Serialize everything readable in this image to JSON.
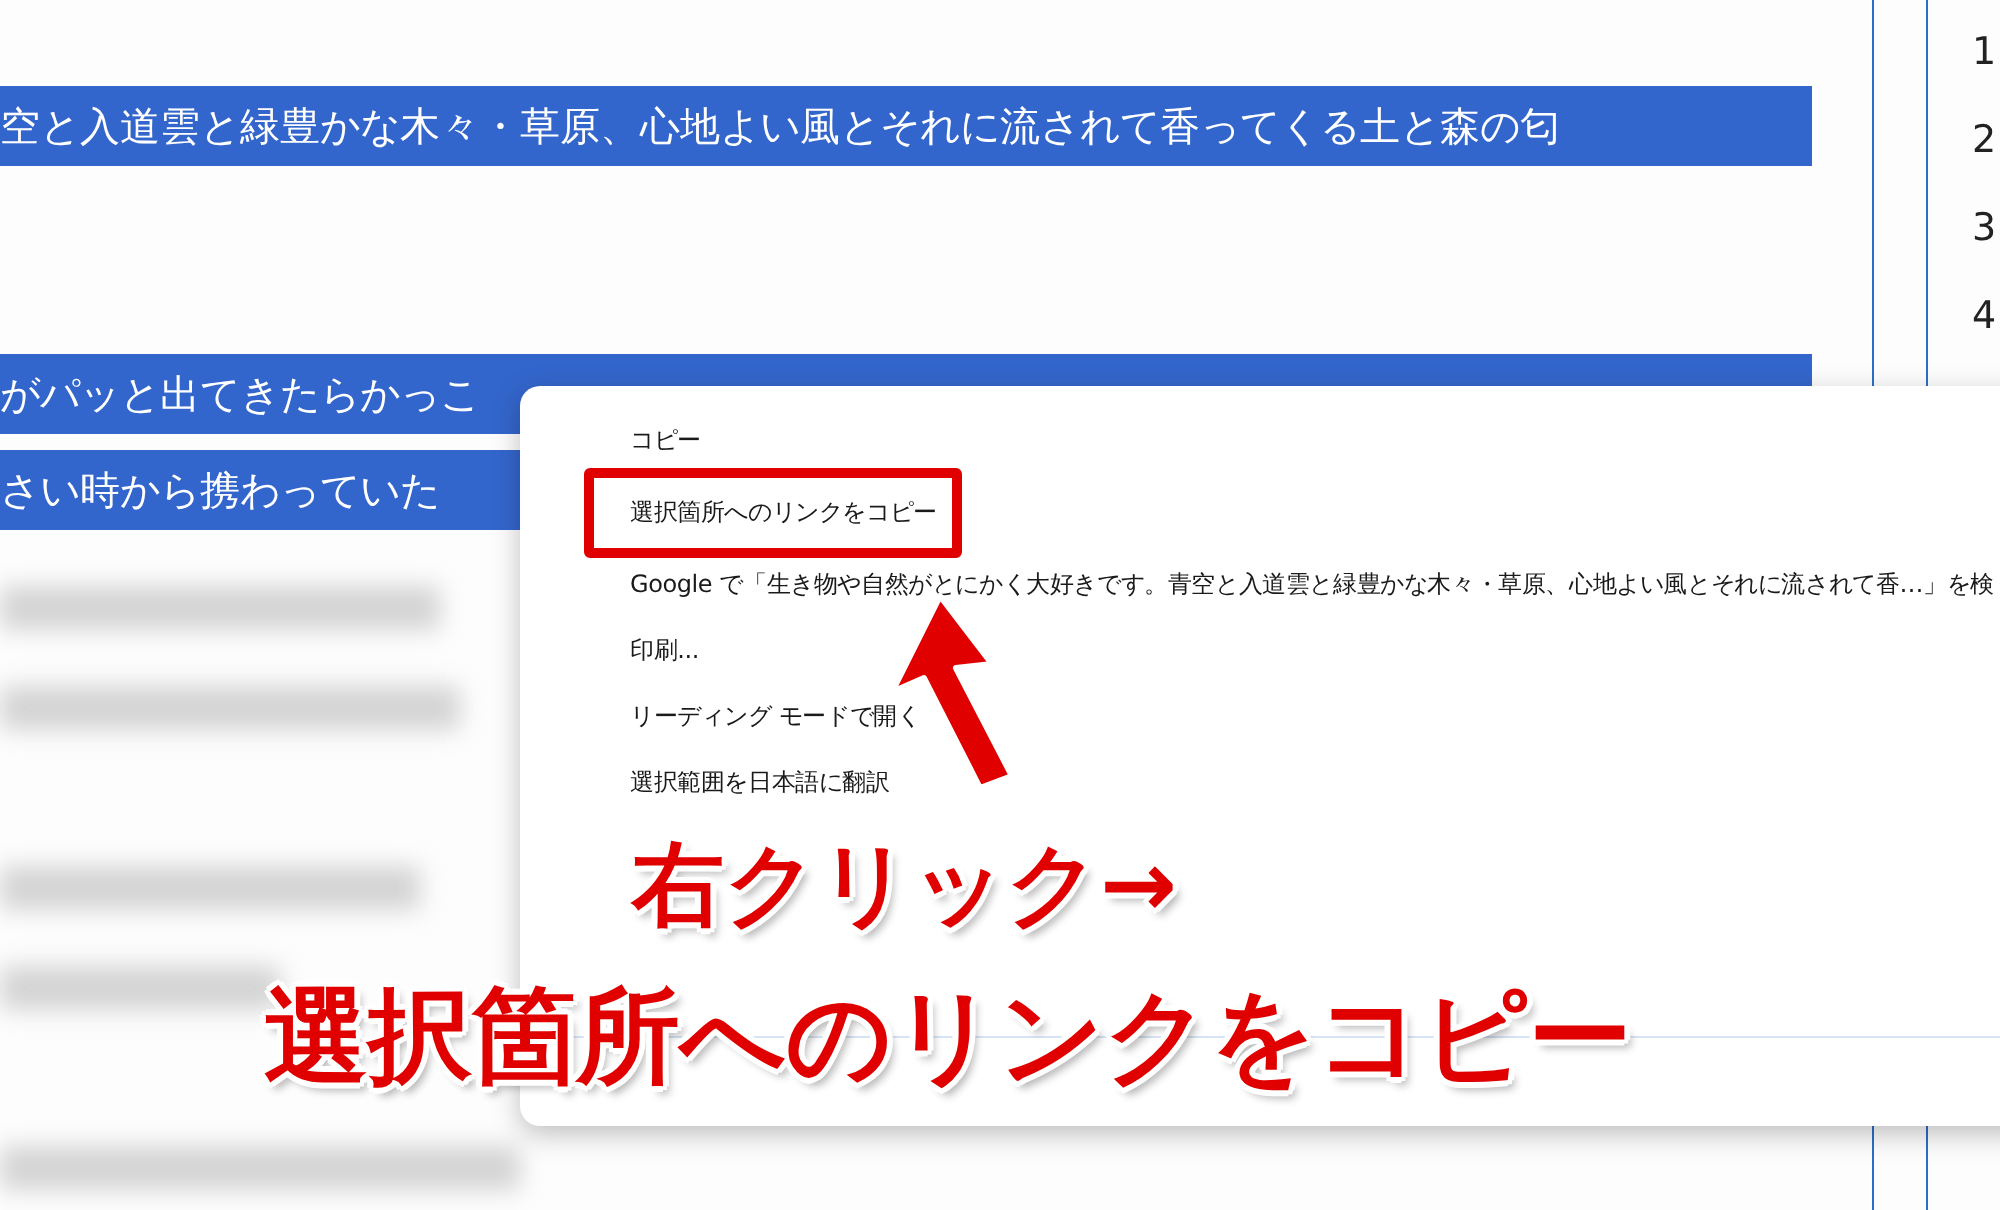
{
  "article": {
    "selected_lines": [
      "空と入道雲と緑豊かな木々・草原、心地よい風とそれに流されて香ってくる土と森の匂",
      "がパッと出てきたらかっこ",
      "さい時から携わっていた"
    ]
  },
  "sidebar": {
    "numbers": [
      "1",
      "2",
      "3",
      "4"
    ]
  },
  "context_menu": {
    "items": [
      {
        "label": "コピー",
        "highlighted": false
      },
      {
        "label": "選択箇所へのリンクをコピー",
        "highlighted": true
      },
      {
        "label": "Google で「生き物や自然がとにかく大好きです。青空と入道雲と緑豊かな木々・草原、心地よい風とそれに流されて香…」を検",
        "highlighted": false
      },
      {
        "label": "印刷...",
        "highlighted": false
      },
      {
        "label": "リーディング モードで開く",
        "highlighted": false
      },
      {
        "label": "選択範囲を日本語に翻訳",
        "highlighted": false
      }
    ]
  },
  "annotation": {
    "lines": [
      "右クリック→",
      "選択箇所へのリンクをコピー"
    ]
  }
}
